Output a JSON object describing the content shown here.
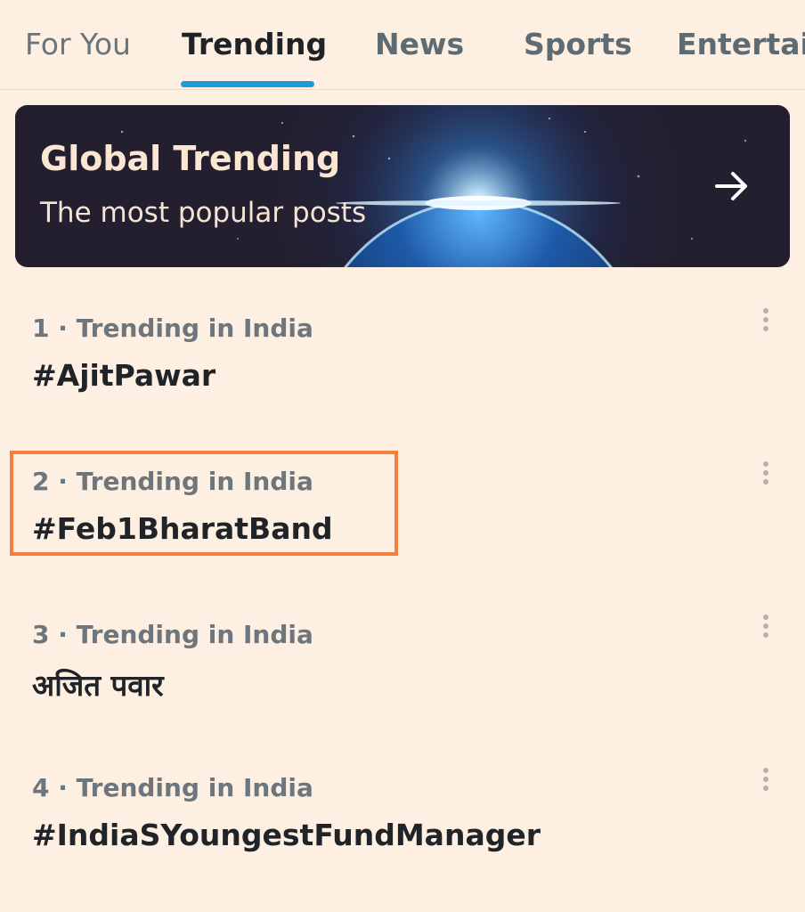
{
  "tabs": [
    {
      "label": "For You"
    },
    {
      "label": "Trending"
    },
    {
      "label": "News"
    },
    {
      "label": "Sports"
    },
    {
      "label": "Entertain"
    }
  ],
  "active_tab": "Trending",
  "accent_color": "#1d9bd8",
  "highlight_color": "#f47f3a",
  "banner": {
    "title": "Global Trending",
    "subtitle": "The most popular posts",
    "icon": "arrow-right-icon"
  },
  "trends": [
    {
      "meta": "1 · Trending in India",
      "name": "#AjitPawar"
    },
    {
      "meta": "2 · Trending in India",
      "name": "#Feb1BharatBand"
    },
    {
      "meta": "3 · Trending in India",
      "name": "अजित पवार"
    },
    {
      "meta": "4 · Trending in India",
      "name": "#IndiaSYoungestFundManager"
    }
  ]
}
